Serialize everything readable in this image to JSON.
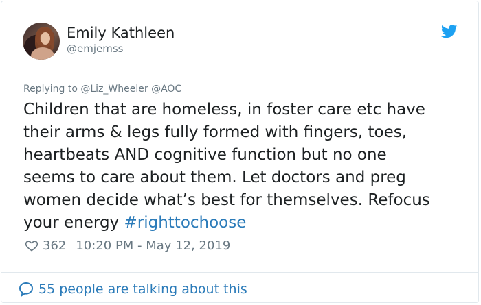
{
  "user": {
    "name": "Emily Kathleen",
    "handle": "@emjemss"
  },
  "tweet": {
    "replying_to": "Replying to @Liz_Wheeler @AOC",
    "text_lines": [
      "Children that are homeless, in foster care etc have",
      "their arms & legs fully formed with fingers, toes,",
      "heartbeats AND cognitive function but no one",
      "seems to care about them. Let doctors and preg",
      "women decide what’s best for themselves. Refocus",
      "your energy "
    ],
    "hashtag": "#righttochoose",
    "likes": "362",
    "timestamp": "10:20 PM - May 12, 2019"
  },
  "footer": {
    "talking": "55 people are talking about this"
  },
  "icons": {
    "logo": "twitter-bird-icon",
    "like": "heart-icon",
    "conversation": "speech-bubble-icon"
  },
  "colors": {
    "brand": "#1da1f2",
    "link": "#2b7bb9",
    "text": "#1c2022",
    "muted": "#697882",
    "border": "#e1e8ed"
  }
}
